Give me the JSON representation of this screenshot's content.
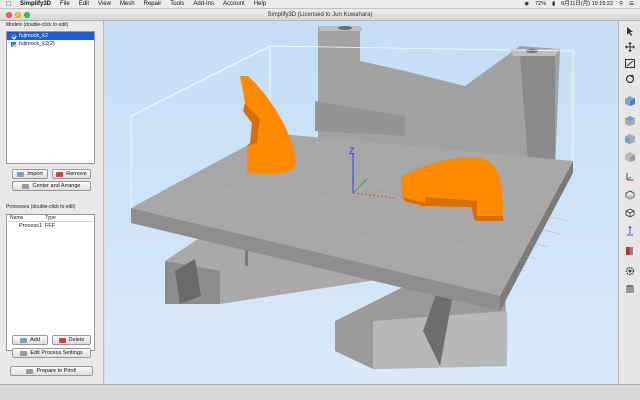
{
  "menubar": {
    "apple": "",
    "items": [
      "Simplify3D",
      "File",
      "Edit",
      "View",
      "Mesh",
      "Repair",
      "Tools",
      "Add-Ins",
      "Account",
      "Help"
    ],
    "battery": "72%",
    "datetime": "6月11日(月) 19:15:22"
  },
  "window": {
    "title": "Simplify3D (Licensed to Jun Kuwahara)"
  },
  "models": {
    "label": "Models (double-click to edit)",
    "items": [
      {
        "name": "fujimock_k2",
        "checked": true,
        "selected": true
      },
      {
        "name": "fujimock_k2(2)",
        "checked": true,
        "selected": false
      }
    ],
    "import_label": "Import",
    "remove_label": "Remove",
    "center_label": "Center and Arrange"
  },
  "processes": {
    "label": "Processes (double-click to edit)",
    "col_name": "Name",
    "col_type": "Type",
    "rows": [
      {
        "name": "Process1",
        "type": "FFF"
      }
    ],
    "add_label": "Add",
    "delete_label": "Delete",
    "edit_label": "Edit Process Settings",
    "prepare_label": "Prepare to Print!"
  },
  "viewport": {
    "axis_z": "Z",
    "model_color": "#ff8a00",
    "bed_color": "#a6a6a6"
  },
  "toolbar": {
    "tools": [
      "pointer-icon",
      "move-icon",
      "scale-icon",
      "rotate-icon",
      "view-iso-icon",
      "view-top-icon",
      "view-front-icon",
      "view-side-icon",
      "axes-icon",
      "build-volume-icon",
      "wireframe-icon",
      "support-icon",
      "cross-section-icon",
      "settings-icon",
      "customize-icon"
    ]
  }
}
